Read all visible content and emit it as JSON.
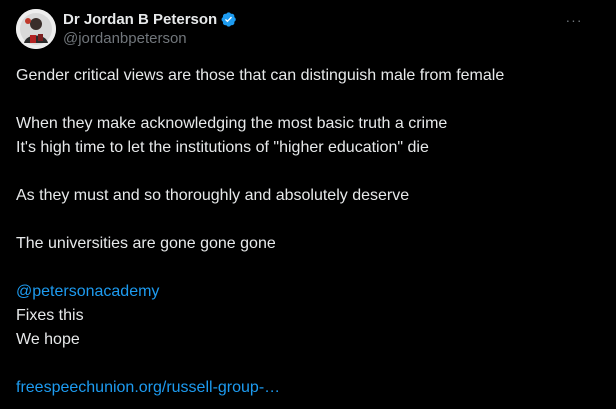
{
  "author": {
    "display_name": "Dr Jordan B Peterson",
    "handle": "@jordanbpeterson",
    "verified_icon": "verified-badge-icon",
    "avatar_icon": "avatar-image"
  },
  "menu_icon": "more-options-icon",
  "tweet": {
    "p1": "Gender critical views are those that can distinguish male from female",
    "p2_l1": "When they make acknowledging the most basic truth a crime",
    "p2_l2": "It's high time to let the institutions of \"higher education\" die",
    "p3": "As they must and so thoroughly and absolutely deserve",
    "p4": "The universities are gone gone gone",
    "mention": "@petersonacademy",
    "p5_l1": "Fixes this",
    "p5_l2": "We hope",
    "url": "freespeechunion.org/russell-group-…"
  },
  "colors": {
    "background": "#000000",
    "text": "#e7e9ea",
    "secondary": "#71767b",
    "link": "#1d9bf0"
  }
}
